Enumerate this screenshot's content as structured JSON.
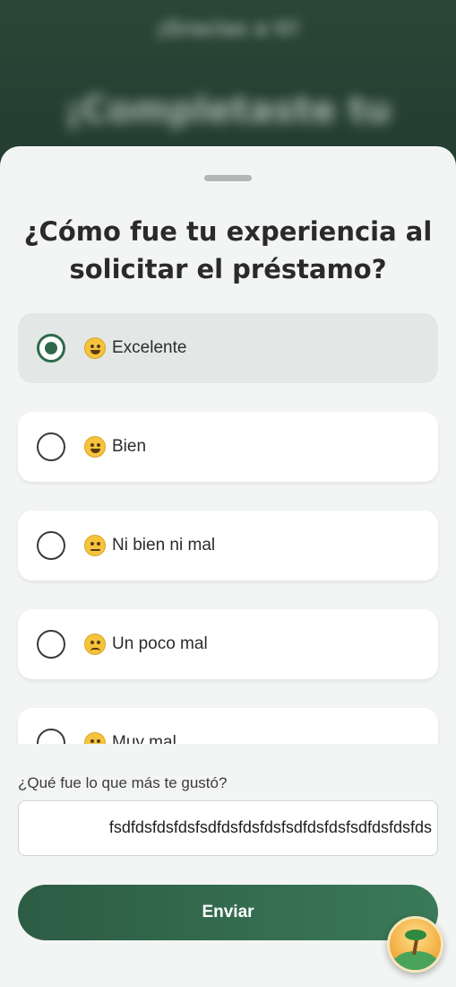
{
  "background": {
    "subtitle_blurred": "¡Gracias a ti!",
    "title_blurred": "¡Completaste tu"
  },
  "sheet": {
    "question": "¿Cómo fue tu experiencia al solicitar el préstamo?",
    "options": [
      {
        "label": "Excelente",
        "emoji": "star-struck-emoji-icon",
        "selected": true
      },
      {
        "label": "Bien",
        "emoji": "grinning-face-emoji-icon",
        "selected": false
      },
      {
        "label": "Ni bien ni mal",
        "emoji": "neutral-face-emoji-icon",
        "selected": false
      },
      {
        "label": "Un poco mal",
        "emoji": "confused-face-emoji-icon",
        "selected": false
      },
      {
        "label": "Muy mal",
        "emoji": "grimacing-face-emoji-icon",
        "selected": false
      }
    ],
    "feedback": {
      "label": "¿Qué fue lo que más te gustó?",
      "value": "fsdfdsfdsfdsfsdfdsfdsfdsfsdfdsfdsfsdfdsfdsfds"
    },
    "submit_label": "Enviar"
  },
  "fab": {
    "icon": "island-palm-icon"
  },
  "colors": {
    "accent": "#2f6a4b",
    "sheet_bg": "#f3f5f4",
    "selected_option_bg": "#e3e8e6"
  }
}
